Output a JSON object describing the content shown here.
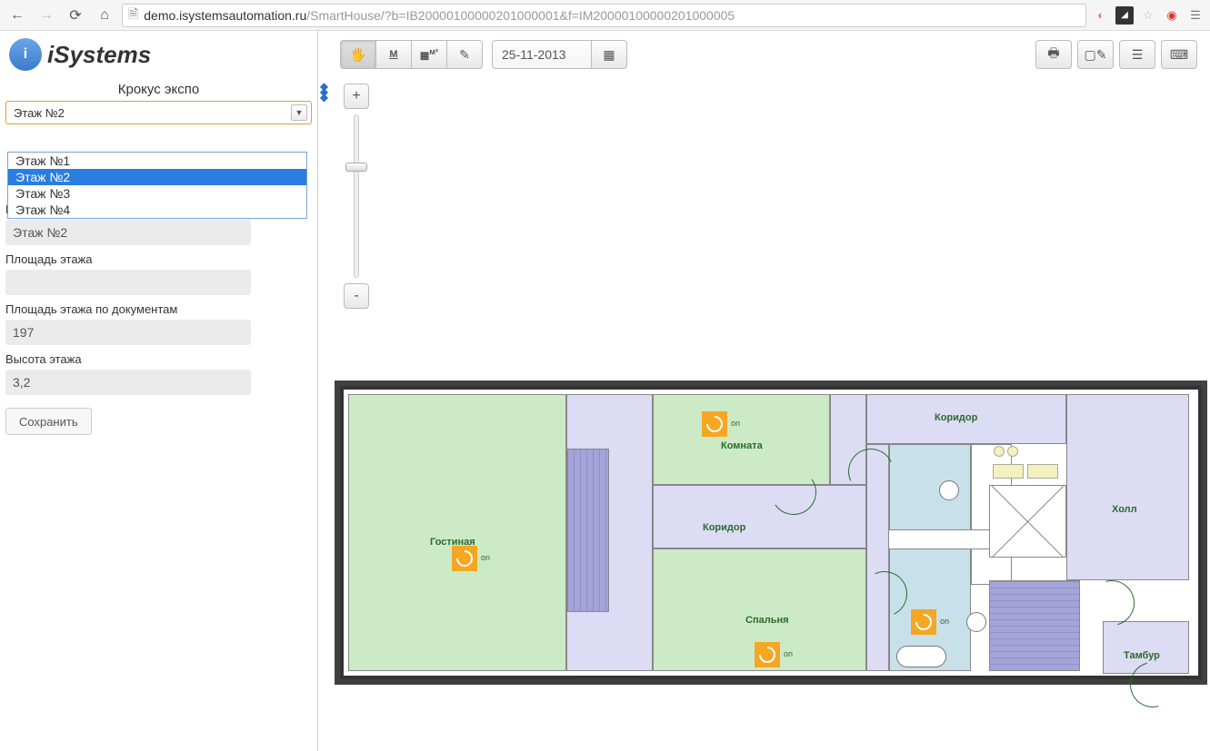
{
  "browser": {
    "url_domain": "demo.isystemsautomation.ru",
    "url_path": "/SmartHouse/?b=IB20000100000201000001&f=IM20000100000201000005"
  },
  "logo_text": "iSystems",
  "building_title": "Крокус экспо",
  "floor_select": {
    "value": "Этаж №2"
  },
  "floor_options": [
    "Этаж №1",
    "Этаж №2",
    "Этаж №3",
    "Этаж №4"
  ],
  "form": {
    "name_label": "Название этажа",
    "name_value": "Этаж №2",
    "area_label": "Площадь этажа",
    "area_value": "",
    "doc_area_label": "Площадь этажа по документам",
    "doc_area_value": "197",
    "height_label": "Высота этажа",
    "height_value": "3,2",
    "save_label": "Сохранить"
  },
  "toolbar": {
    "date": "25-11-2013",
    "hand": "✋",
    "measure": "M",
    "area": "M²",
    "edit": "✎",
    "calendar": "▦",
    "print": "🖶",
    "note": "✎",
    "list": "☰",
    "layout": "▭",
    "zoom_in": "+",
    "zoom_out": "-"
  },
  "rooms": {
    "living": "Гостиная",
    "room": "Комната",
    "corridor": "Коридор",
    "corridor2": "Коридор",
    "bedroom": "Спальня",
    "hall": "Холл",
    "tambur": "Тамбур"
  },
  "light_status": "on"
}
